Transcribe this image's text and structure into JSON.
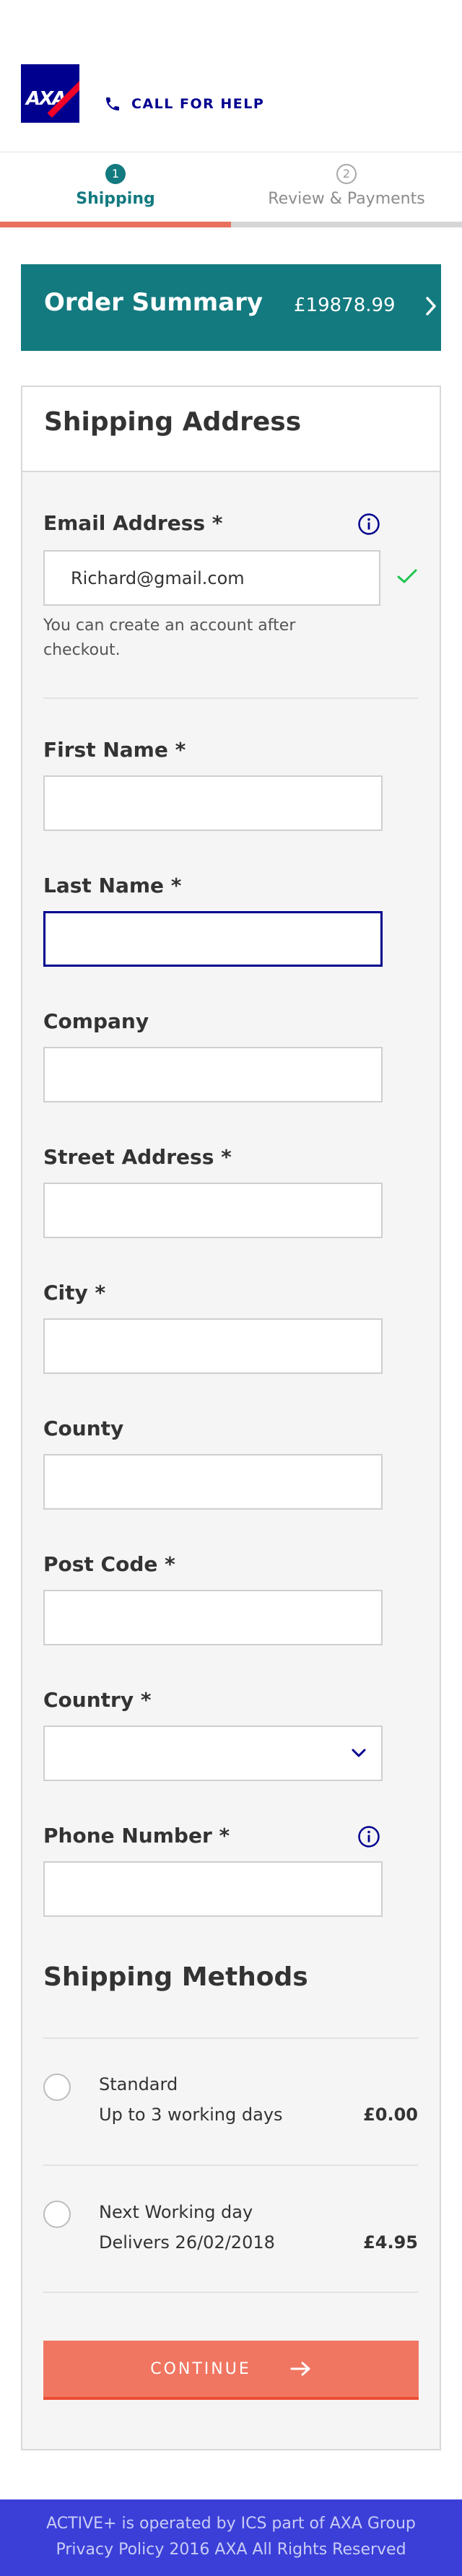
{
  "header": {
    "logo_text": "AXA",
    "call_label": "CALL FOR HELP",
    "phone_icon": "phone-icon"
  },
  "steps": [
    {
      "number": "1",
      "label": "Shipping",
      "active": true
    },
    {
      "number": "2",
      "label": "Review & Payments",
      "active": false
    }
  ],
  "progress": {
    "completed_fraction": 0.5
  },
  "order_summary": {
    "title": "Order Summary",
    "price": "£19878.99",
    "icon": "chevron-right-icon"
  },
  "shipping_address": {
    "title": "Shipping Address",
    "email": {
      "label": "Email Address *",
      "value": "Richard@gmail.com",
      "hint": "You can create an account after checkout.",
      "valid": true
    },
    "first_name": {
      "label": "First Name *",
      "value": ""
    },
    "last_name": {
      "label": "Last Name *",
      "value": ""
    },
    "company": {
      "label": "Company",
      "value": ""
    },
    "street": {
      "label": "Street Address *",
      "value": ""
    },
    "city": {
      "label": "City *",
      "value": ""
    },
    "county": {
      "label": "County",
      "value": ""
    },
    "postcode": {
      "label": "Post Code *",
      "value": ""
    },
    "country": {
      "label": "Country *",
      "value": ""
    },
    "phone": {
      "label": "Phone Number *",
      "value": ""
    }
  },
  "shipping_methods": {
    "title": "Shipping Methods",
    "items": [
      {
        "name": "Standard",
        "detail": "Up to 3 working days",
        "price": "£0.00"
      },
      {
        "name": "Next Working day",
        "detail": "Delivers 26/02/2018",
        "price": "£4.95"
      }
    ]
  },
  "continue_label": "CONTINUE",
  "footer": {
    "line1": "ACTIVE+ is operated by ICS part of AXA Group",
    "line2": "Privacy Policy 2016 AXA All Rights Reserved"
  },
  "colors": {
    "brand_blue": "#00008f",
    "teal": "#137a7f",
    "coral": "#f07662",
    "footer_blue": "#3b3fd8",
    "success_green": "#1cc54e"
  }
}
